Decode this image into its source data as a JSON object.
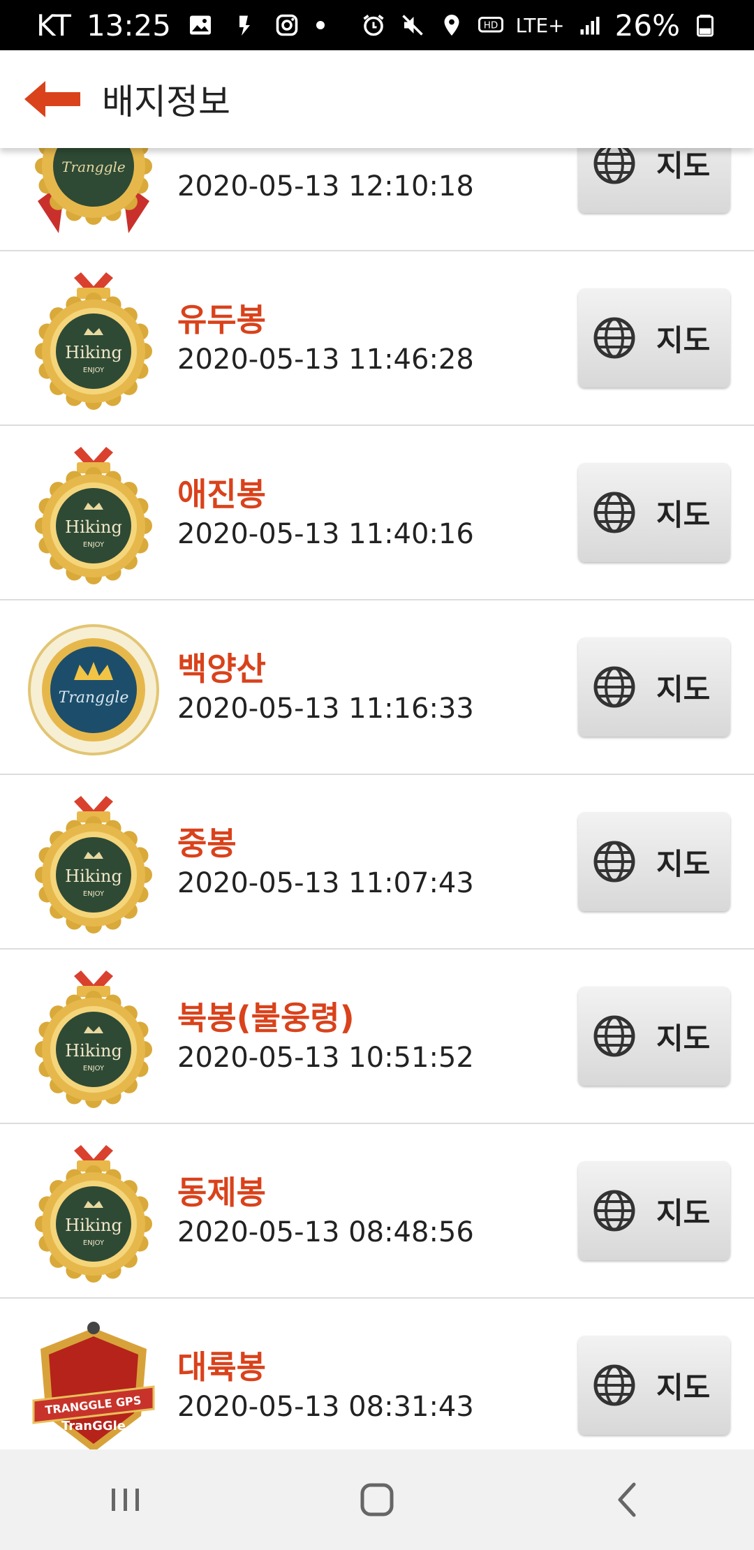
{
  "status_bar": {
    "carrier": "KT",
    "time": "13:25",
    "network": "LTE+",
    "battery": "26%"
  },
  "header": {
    "title": "배지정보",
    "back_icon": "arrow-left-icon",
    "accent_color": "#d9421b"
  },
  "badges": [
    {
      "name": "",
      "time": "2020-05-13 12:10:18",
      "badge_icon": "tranggle-gold-badge",
      "map_label": "지도"
    },
    {
      "name": "유두봉",
      "time": "2020-05-13 11:46:28",
      "badge_icon": "hiking-enjoy-badge",
      "map_label": "지도"
    },
    {
      "name": "애진봉",
      "time": "2020-05-13 11:40:16",
      "badge_icon": "hiking-enjoy-badge",
      "map_label": "지도"
    },
    {
      "name": "백양산",
      "time": "2020-05-13 11:16:33",
      "badge_icon": "tranggle-crown-badge",
      "map_label": "지도"
    },
    {
      "name": "중봉",
      "time": "2020-05-13 11:07:43",
      "badge_icon": "hiking-enjoy-badge",
      "map_label": "지도"
    },
    {
      "name": "북봉(불웅령)",
      "time": "2020-05-13 10:51:52",
      "badge_icon": "hiking-enjoy-badge",
      "map_label": "지도"
    },
    {
      "name": "동제봉",
      "time": "2020-05-13 08:48:56",
      "badge_icon": "hiking-enjoy-badge",
      "map_label": "지도"
    },
    {
      "name": "대륙봉",
      "time": "2020-05-13 08:31:43",
      "badge_icon": "tranggle-gps-shield-badge",
      "map_label": "지도"
    }
  ],
  "badge_text": {
    "hiking": "Hiking",
    "enjoy": "ENJOY",
    "tranggle": "Tranggle",
    "tranggle_gps": "TRANGGLE GPS",
    "tranggle_logo": "TranGGle"
  },
  "nav": {
    "recents_icon": "recents-icon",
    "home_icon": "home-icon",
    "back_icon": "back-chevron-icon"
  }
}
